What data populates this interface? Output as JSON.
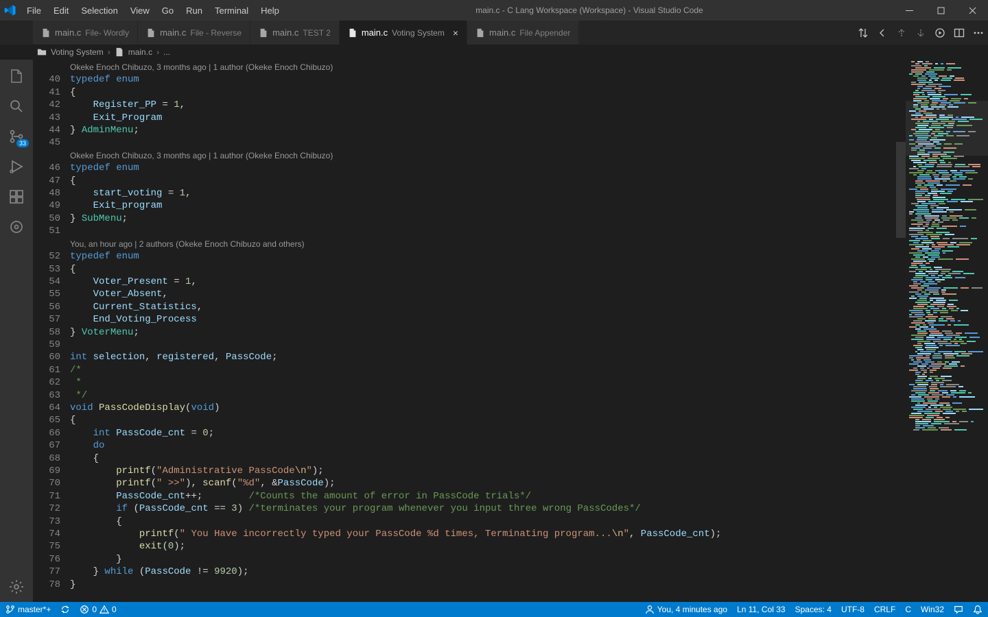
{
  "titlebar": {
    "title": "main.c - C Lang Workspace (Workspace) - Visual Studio Code",
    "menu": [
      "File",
      "Edit",
      "Selection",
      "View",
      "Go",
      "Run",
      "Terminal",
      "Help"
    ]
  },
  "tabs": [
    {
      "name": "main.c",
      "desc": "File- Wordly",
      "active": false
    },
    {
      "name": "main.c",
      "desc": "File - Reverse",
      "active": false
    },
    {
      "name": "main.c",
      "desc": "TEST 2",
      "active": false
    },
    {
      "name": "main.c",
      "desc": "Voting System",
      "active": true,
      "close": true
    },
    {
      "name": "main.c",
      "desc": "File Appender",
      "active": false
    }
  ],
  "breadcrumb": {
    "parts": [
      "Voting System",
      "main.c",
      "..."
    ]
  },
  "activitybar": {
    "scm_badge": "33"
  },
  "statusbar": {
    "branch": "master*+",
    "errors": "0",
    "warnings": "0",
    "blame": "You, 4 minutes ago",
    "lncol": "Ln 11, Col 33",
    "spaces": "Spaces: 4",
    "encoding": "UTF-8",
    "eol": "CRLF",
    "lang": "C",
    "platform": "Win32"
  },
  "codelens": {
    "l0": "Okeke Enoch Chibuzo, 3 months ago | 1 author (Okeke Enoch Chibuzo)",
    "l1": "Okeke Enoch Chibuzo, 3 months ago | 1 author (Okeke Enoch Chibuzo)",
    "l2": "You, an hour ago | 2 authors (Okeke Enoch Chibuzo and others)"
  },
  "gutter": {
    "start": 40,
    "end": 78
  },
  "code": {
    "AdminMenu": "AdminMenu",
    "SubMenu": "SubMenu",
    "VoterMenu": "VoterMenu",
    "typedef": "typedef",
    "enum": "enum",
    "Register_PP": "Register_PP",
    "Exit_Program": "Exit_Program",
    "start_voting": "start_voting",
    "Exit_program": "Exit_program",
    "Voter_Present": "Voter_Present",
    "Voter_Absent": "Voter_Absent",
    "Current_Statistics": "Current_Statistics",
    "End_Voting_Process": "End_Voting_Process",
    "int": "int",
    "selection": "selection",
    "registered": "registered",
    "PassCode": "PassCode",
    "void": "void",
    "PassCodeDisplay": "PassCodeDisplay",
    "PassCode_cnt": "PassCode_cnt",
    "do": "do",
    "printf": "printf",
    "scanf": "scanf",
    "if": "if",
    "while": "while",
    "exit": "exit",
    "str_adminpass": "\"Administrative PassCode\\n\"",
    "str_prompt": "\" >>\"",
    "str_d": "\"%d\"",
    "cm_counts": "/*Counts the amount of error in PassCode trials*/",
    "cm_term": "/*terminates your program whenever you input three wrong PassCodes*/",
    "str_term": "\" You Have incorrectly typed your PassCode %d times, Terminating program...\\n\"",
    "cm_block_open": "/*",
    "cm_block_star": " *",
    "cm_block_close": " */"
  }
}
